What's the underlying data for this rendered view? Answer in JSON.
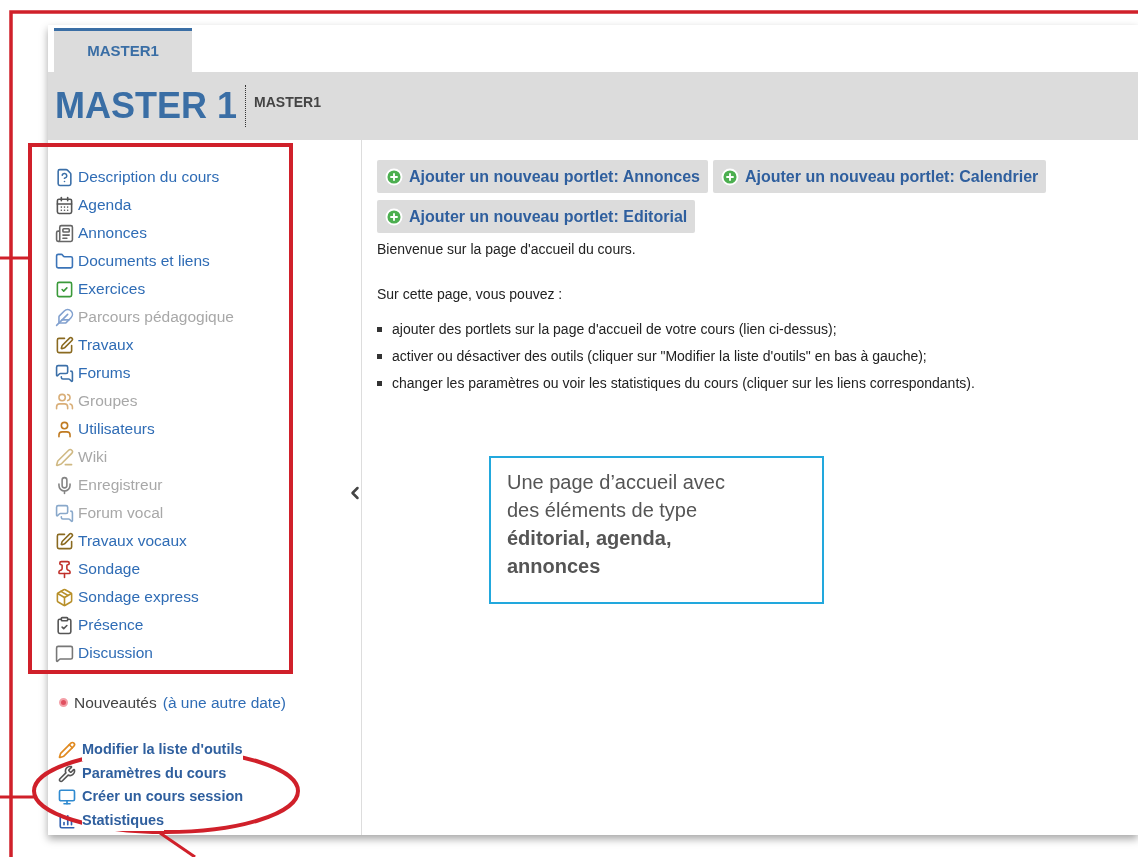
{
  "tab": {
    "label": "MASTER1",
    "selected": true
  },
  "header": {
    "title": "MASTER 1",
    "code": "MASTER1"
  },
  "tools": [
    {
      "label": "Description du cours",
      "disabled": false
    },
    {
      "label": "Agenda",
      "disabled": false
    },
    {
      "label": "Annonces",
      "disabled": false
    },
    {
      "label": "Documents et liens",
      "disabled": false
    },
    {
      "label": "Exercices",
      "disabled": false
    },
    {
      "label": "Parcours pédagogique",
      "disabled": true
    },
    {
      "label": "Travaux",
      "disabled": false
    },
    {
      "label": "Forums",
      "disabled": false
    },
    {
      "label": "Groupes",
      "disabled": true
    },
    {
      "label": "Utilisateurs",
      "disabled": false
    },
    {
      "label": "Wiki",
      "disabled": true
    },
    {
      "label": "Enregistreur",
      "disabled": true
    },
    {
      "label": "Forum vocal",
      "disabled": true
    },
    {
      "label": "Travaux vocaux",
      "disabled": false
    },
    {
      "label": "Sondage",
      "disabled": false
    },
    {
      "label": "Sondage express",
      "disabled": false
    },
    {
      "label": "Présence",
      "disabled": false
    },
    {
      "label": "Discussion",
      "disabled": false
    }
  ],
  "news": {
    "label": "Nouveautés",
    "link": "(à une autre date)"
  },
  "admin_links": [
    "Modifier la liste d'outils",
    "Paramètres du cours",
    "Créer un cours session",
    "Statistiques"
  ],
  "portlet_buttons": [
    "Ajouter un nouveau portlet: Annonces",
    "Ajouter un nouveau portlet: Calendrier",
    "Ajouter un nouveau portlet: Editorial"
  ],
  "intro": "Bienvenue sur la page d'accueil du cours.",
  "lead": "Sur cette page, vous pouvez :",
  "bullets": [
    "ajouter des portlets sur la page d'accueil de votre cours (lien ci-dessus);",
    "activer ou désactiver des outils (cliquer sur \"Modifier la liste d'outils\" en bas à gauche);",
    "changer les paramètres ou voir les statistiques du cours (cliquer sur les liens correspondants)."
  ],
  "callout": "Une page d’accueil avec des éléments de type **éditorial, agenda, annonces**"
}
